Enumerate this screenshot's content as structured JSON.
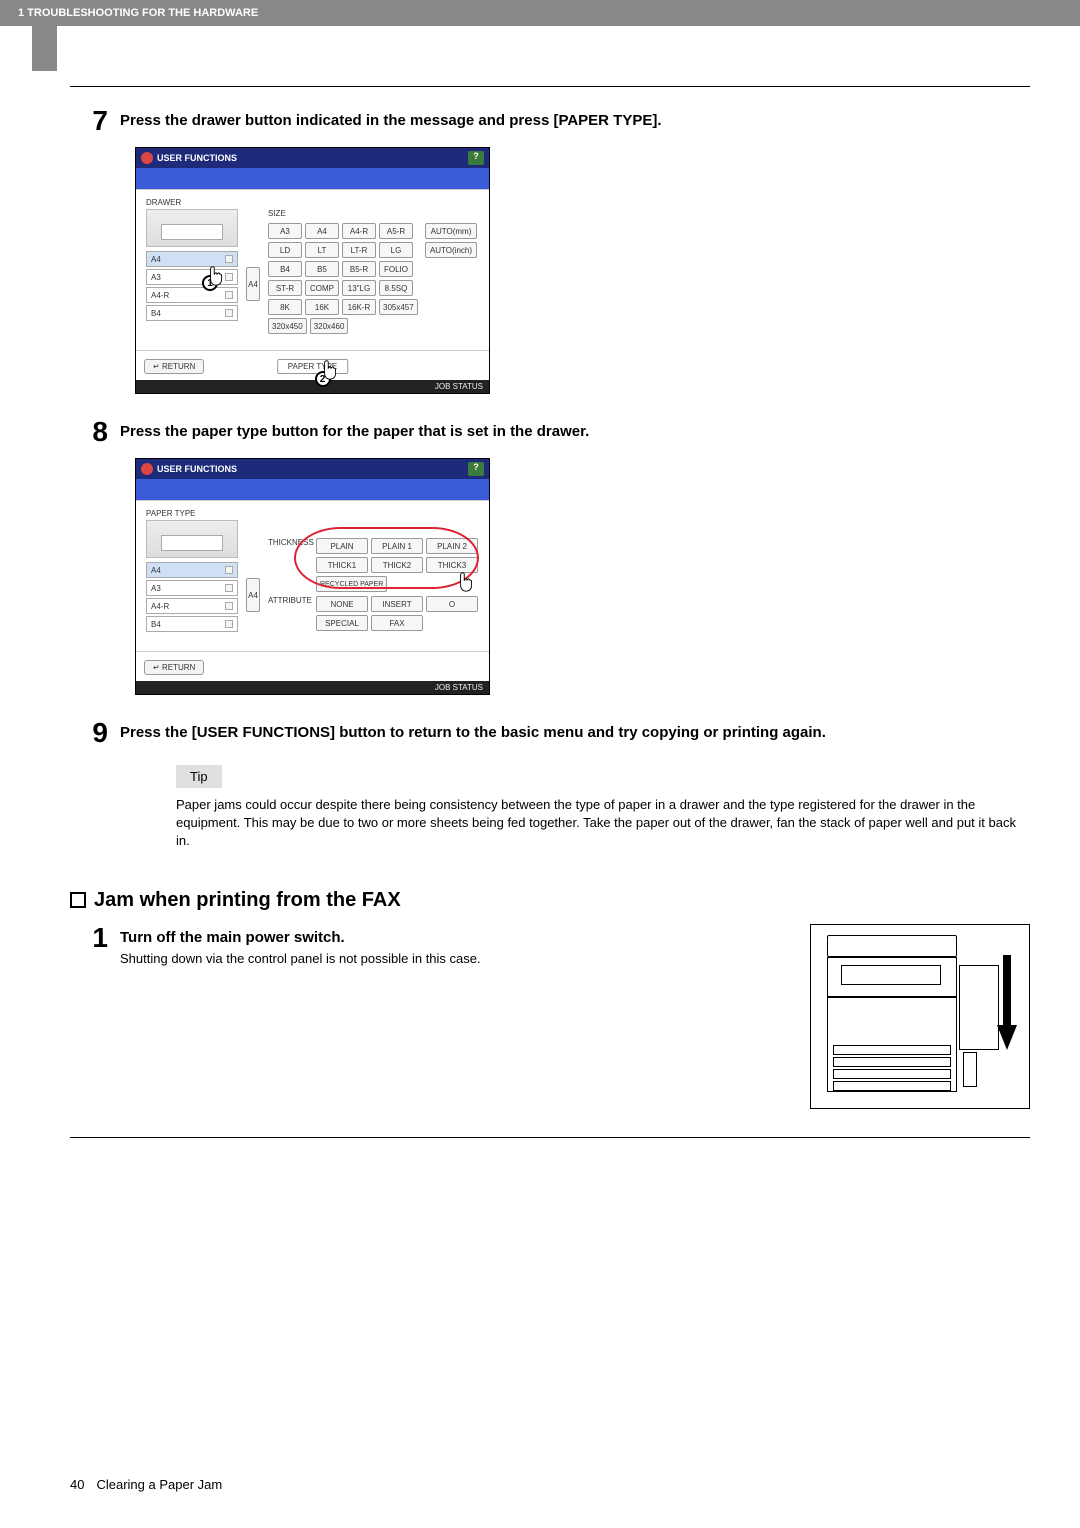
{
  "header": {
    "chapter": "1 TROUBLESHOOTING FOR THE HARDWARE"
  },
  "steps": {
    "s7": {
      "num": "7",
      "title": "Press the drawer button indicated in the message and press [PAPER TYPE]."
    },
    "s8": {
      "num": "8",
      "title": "Press the paper type button for the paper that is set in the drawer."
    },
    "s9": {
      "num": "9",
      "title": "Press the [USER FUNCTIONS] button to return to the basic menu and try copying or printing again."
    },
    "s1": {
      "num": "1",
      "title": "Turn off the main power switch.",
      "sub": "Shutting down via the control panel is not possible in this case."
    }
  },
  "panel_common": {
    "title": "USER FUNCTIONS",
    "return": "RETURN",
    "status": "JOB STATUS",
    "help": "?"
  },
  "panel7": {
    "drawer_label": "DRAWER",
    "size_label": "SIZE",
    "items": [
      "A4",
      "A3",
      "A4-R",
      "B4"
    ],
    "side": "A4",
    "sizes": [
      [
        "A3",
        "A4",
        "A4-R",
        "A5-R"
      ],
      [
        "LD",
        "LT",
        "LT-R",
        "LG"
      ],
      [
        "B4",
        "B5",
        "B5-R",
        "FOLIO"
      ],
      [
        "ST-R",
        "COMP",
        "13\"LG",
        "8.5SQ"
      ],
      [
        "8K",
        "16K",
        "16K-R",
        "305x457"
      ],
      [
        "320x450",
        "320x460"
      ]
    ],
    "autos": [
      "AUTO(mm)",
      "AUTO(inch)"
    ],
    "paper_type": "PAPER TYPE",
    "badge1": "1",
    "badge2": "2"
  },
  "panel8": {
    "paper_type_label": "PAPER TYPE",
    "items": [
      "A4",
      "A3",
      "A4-R",
      "B4"
    ],
    "side": "A4",
    "thickness": "THICKNESS",
    "attribute": "ATTRIBUTE",
    "row1": [
      "PLAIN",
      "PLAIN 1",
      "PLAIN 2"
    ],
    "row2": [
      "THICK1",
      "THICK2",
      "THICK3"
    ],
    "row3": [
      "RECYCLED PAPER"
    ],
    "attr_row1": [
      "NONE",
      "INSERT",
      "O"
    ],
    "attr_row2": [
      "SPECIAL",
      "FAX"
    ]
  },
  "tip": {
    "tag": "Tip",
    "text": "Paper jams could occur despite there being consistency between the type of paper in a drawer and the type registered for the drawer in the equipment. This may be due to two or more sheets being fed together. Take the paper out of the drawer, fan the stack of paper well and put it back in."
  },
  "section": {
    "title": "Jam when printing from the FAX"
  },
  "footer": {
    "page": "40",
    "title": "Clearing a Paper Jam"
  }
}
